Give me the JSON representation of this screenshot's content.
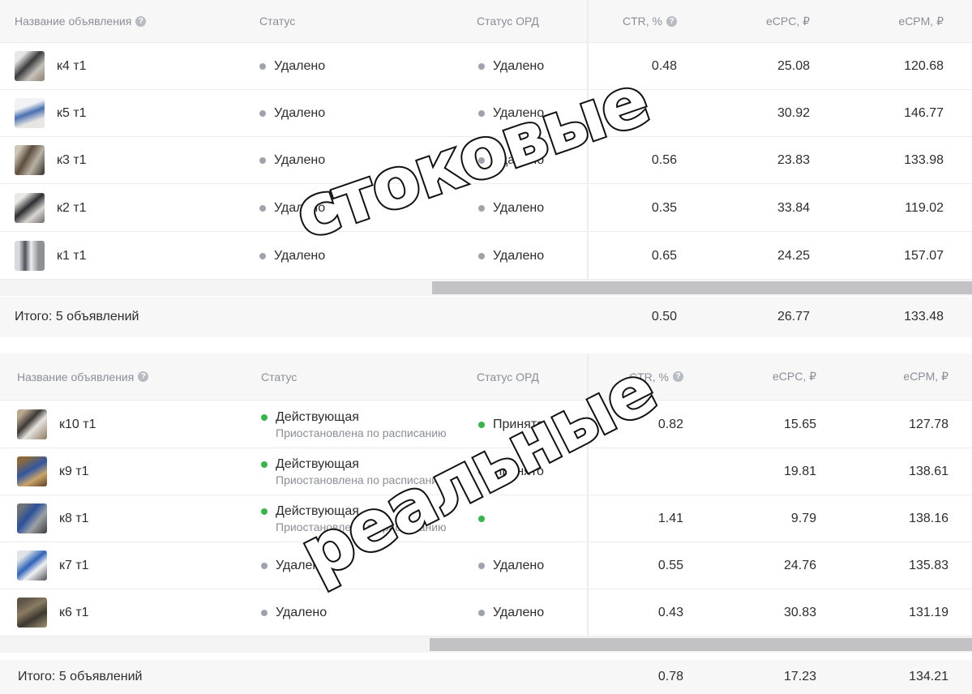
{
  "columns": {
    "name": "Название объявления",
    "status": "Статус",
    "ord": "Статус ОРД",
    "ctr": "CTR, %",
    "ecpc": "eCPC, ₽",
    "ecpm": "eCPM, ₽"
  },
  "table1": {
    "rows": [
      {
        "name": "к4 т1",
        "status": "Удалено",
        "ord": "Удалено",
        "ctr": "0.48",
        "ecpc": "25.08",
        "ecpm": "120.68"
      },
      {
        "name": "к5 т1",
        "status": "Удалено",
        "ord": "Удалено",
        "ctr": "",
        "ecpc": "30.92",
        "ecpm": "146.77"
      },
      {
        "name": "к3 т1",
        "status": "Удалено",
        "ord": "Удалено",
        "ctr": "0.56",
        "ecpc": "23.83",
        "ecpm": "133.98"
      },
      {
        "name": "к2 т1",
        "status": "Удалено",
        "ord": "Удалено",
        "ctr": "0.35",
        "ecpc": "33.84",
        "ecpm": "119.02"
      },
      {
        "name": "к1 т1",
        "status": "Удалено",
        "ord": "Удалено",
        "ctr": "0.65",
        "ecpc": "24.25",
        "ecpm": "157.07"
      }
    ],
    "summary": {
      "label": "Итого: 5 объявлений",
      "ctr": "0.50",
      "ecpc": "26.77",
      "ecpm": "133.48"
    }
  },
  "table2": {
    "rows": [
      {
        "name": "к10 т1",
        "status": "Действующая",
        "status_sub": "Приостановлена по расписанию",
        "ord": "Принято",
        "ctr": "0.82",
        "ecpc": "15.65",
        "ecpm": "127.78"
      },
      {
        "name": "к9 т1",
        "status": "Действующая",
        "status_sub": "Приостановлена по расписанию",
        "ord": "Принято",
        "ctr": "",
        "ecpc": "19.81",
        "ecpm": "138.61"
      },
      {
        "name": "к8 т1",
        "status": "Действующая",
        "status_sub": "Приостановлена по расписанию",
        "ord": "",
        "ctr": "1.41",
        "ecpc": "9.79",
        "ecpm": "138.16"
      },
      {
        "name": "к7 т1",
        "status": "Удалено",
        "ord": "Удалено",
        "ctr": "0.55",
        "ecpc": "24.76",
        "ecpm": "135.83"
      },
      {
        "name": "к6 т1",
        "status": "Удалено",
        "ord": "Удалено",
        "ctr": "0.43",
        "ecpc": "30.83",
        "ecpm": "131.19"
      }
    ],
    "summary": {
      "label": "Итого: 5 объявлений",
      "ctr": "0.78",
      "ecpc": "17.23",
      "ecpm": "134.21"
    }
  },
  "overlays": {
    "top": "стоковые",
    "bottom": "реальные"
  },
  "icons": {
    "help": "question-circle-icon",
    "status_dot": "status-dot-icon"
  },
  "colors": {
    "status_grey": "#9fa4ac",
    "status_green": "#3bb34b",
    "header_bg": "#f7f7f8",
    "scrollbar": "#c2c2c4"
  }
}
